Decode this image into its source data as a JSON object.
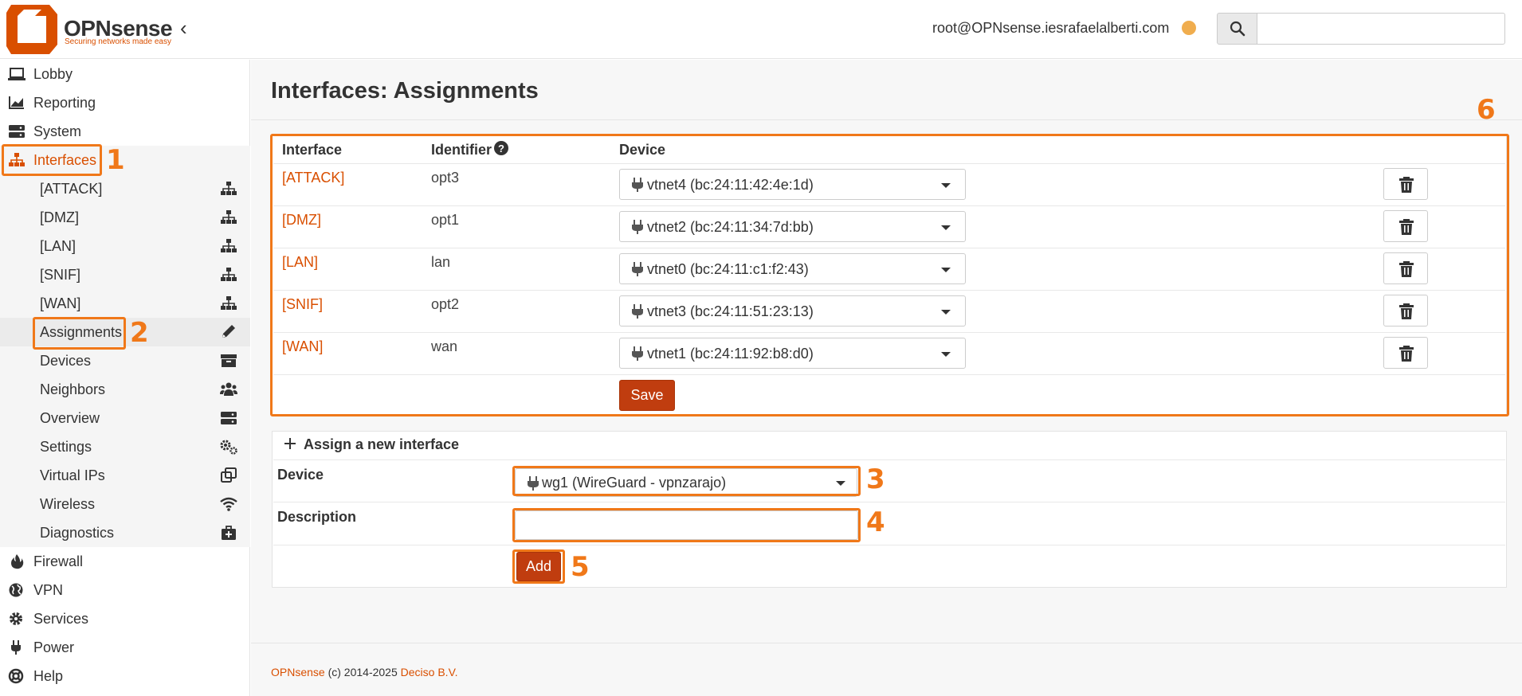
{
  "header": {
    "brand": "OPNsense",
    "tagline": "Securing networks made easy",
    "user": "root@OPNsense.iesrafaelalberti.com",
    "status_color": "#f0ad4e"
  },
  "sidebar": {
    "items": [
      {
        "label": "Lobby",
        "icon": "laptop-icon"
      },
      {
        "label": "Reporting",
        "icon": "chart-icon"
      },
      {
        "label": "System",
        "icon": "server-icon"
      },
      {
        "label": "Interfaces",
        "icon": "sitemap-icon"
      }
    ],
    "interfaces_sub": [
      {
        "label": "[ATTACK]",
        "icon": "sitemap-icon"
      },
      {
        "label": "[DMZ]",
        "icon": "sitemap-icon"
      },
      {
        "label": "[LAN]",
        "icon": "sitemap-icon"
      },
      {
        "label": "[SNIF]",
        "icon": "sitemap-icon"
      },
      {
        "label": "[WAN]",
        "icon": "sitemap-icon"
      },
      {
        "label": "Assignments",
        "icon": "pencil-icon"
      },
      {
        "label": "Devices",
        "icon": "archive-icon"
      },
      {
        "label": "Neighbors",
        "icon": "users-icon"
      },
      {
        "label": "Overview",
        "icon": "server-icon"
      },
      {
        "label": "Settings",
        "icon": "cogs-icon"
      },
      {
        "label": "Virtual IPs",
        "icon": "clone-icon"
      },
      {
        "label": "Wireless",
        "icon": "wifi-icon"
      },
      {
        "label": "Diagnostics",
        "icon": "medkit-icon"
      }
    ],
    "bottom_items": [
      {
        "label": "Firewall",
        "icon": "fire-icon"
      },
      {
        "label": "VPN",
        "icon": "globe-icon"
      },
      {
        "label": "Services",
        "icon": "cog-icon"
      },
      {
        "label": "Power",
        "icon": "plug-icon"
      },
      {
        "label": "Help",
        "icon": "lifebuoy-icon"
      }
    ]
  },
  "page": {
    "title": "Interfaces: Assignments"
  },
  "table": {
    "headers": [
      "Interface",
      "Identifier",
      "Device"
    ],
    "rows": [
      {
        "interface": "[ATTACK]",
        "identifier": "opt3",
        "device": "vtnet4 (bc:24:11:42:4e:1d)"
      },
      {
        "interface": "[DMZ]",
        "identifier": "opt1",
        "device": "vtnet2 (bc:24:11:34:7d:bb)"
      },
      {
        "interface": "[LAN]",
        "identifier": "lan",
        "device": "vtnet0 (bc:24:11:c1:f2:43)"
      },
      {
        "interface": "[SNIF]",
        "identifier": "opt2",
        "device": "vtnet3 (bc:24:11:51:23:13)"
      },
      {
        "interface": "[WAN]",
        "identifier": "wan",
        "device": "vtnet1 (bc:24:11:92:b8:d0)"
      }
    ],
    "save_label": "Save"
  },
  "assign": {
    "title": "Assign a new interface",
    "device_label": "Device",
    "device_value": "wg1 (WireGuard - vpnzarajo)",
    "description_label": "Description",
    "description_value": "",
    "add_label": "Add"
  },
  "annotations": [
    "1",
    "2",
    "3",
    "4",
    "5",
    "6"
  ],
  "footer": {
    "brand": "OPNsense",
    "copyright": " (c) 2014-2025 ",
    "company": "Deciso B.V."
  },
  "colors": {
    "accent": "#d94f00",
    "highlight": "#f07819",
    "button": "#c03d0f"
  }
}
